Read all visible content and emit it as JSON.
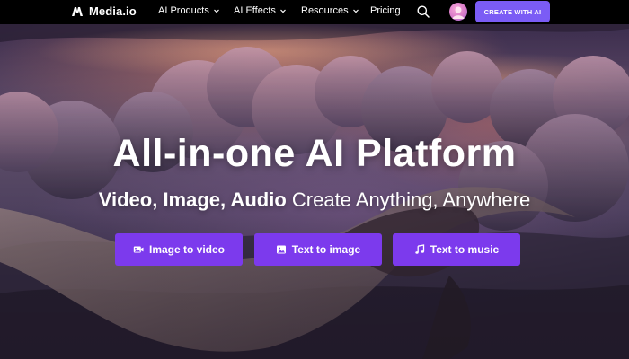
{
  "brand": {
    "name": "Media.io"
  },
  "nav": {
    "items": [
      {
        "label": "AI Products",
        "icon": "chevron-down-icon"
      },
      {
        "label": "AI Effects",
        "icon": "chevron-down-icon"
      },
      {
        "label": "Resources",
        "icon": "chevron-down-icon"
      },
      {
        "label": "Pricing"
      }
    ],
    "search_icon": "search-icon",
    "create_button_label": "CREATE WITH AI"
  },
  "hero": {
    "title": "All-in-one AI Platform",
    "subtitle_bold": "Video, Image, Audio",
    "subtitle_rest": " Create Anything, Anywhere",
    "buttons": [
      {
        "label": "Image to video",
        "icon": "image-video-icon"
      },
      {
        "label": "Text to image",
        "icon": "image-icon"
      },
      {
        "label": "Text to music",
        "icon": "music-note-icon"
      }
    ]
  },
  "colors": {
    "nav_bg": "#000000",
    "accent": "#7c3aed",
    "create_button": "#7b5cf5",
    "text": "#ffffff"
  }
}
